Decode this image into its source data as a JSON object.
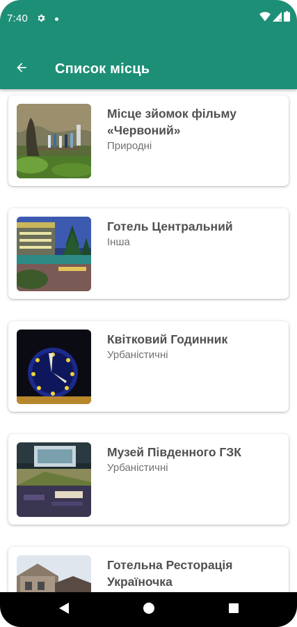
{
  "status_bar": {
    "time": "7:40",
    "icons": [
      "gear-icon",
      "notification-dot-icon",
      "wifi-icon",
      "signal-icon",
      "battery-icon"
    ]
  },
  "app_bar": {
    "title": "Список місць",
    "back_icon": "arrow-left-icon"
  },
  "places": [
    {
      "title": "Місце зйомок фільму «Червоний»",
      "category": "Природні"
    },
    {
      "title": "Готель Центральний",
      "category": "Інша"
    },
    {
      "title": "Квітковий Годинник",
      "category": "Урбаністичні"
    },
    {
      "title": "Музей Південного ГЗК",
      "category": "Урбаністичні"
    },
    {
      "title": "Готельна Ресторація Україночка",
      "category": ""
    }
  ],
  "nav_bar": {
    "buttons": [
      "back-triangle-icon",
      "home-circle-icon",
      "recents-square-icon"
    ]
  },
  "colors": {
    "primary": "#1e8f77",
    "title_text": "#505050",
    "category_text": "#707070"
  }
}
